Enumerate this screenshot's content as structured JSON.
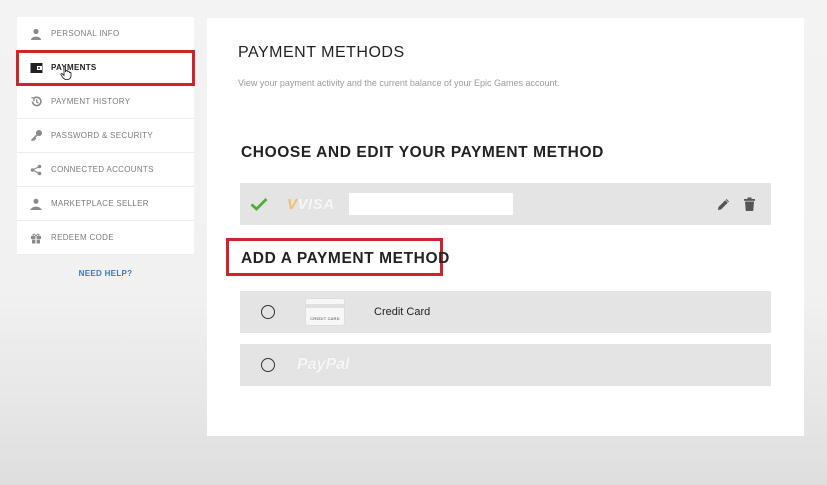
{
  "sidebar": {
    "items": [
      {
        "label": "PERSONAL INFO",
        "icon": "person-icon"
      },
      {
        "label": "PAYMENTS",
        "icon": "wallet-icon",
        "active": true
      },
      {
        "label": "PAYMENT HISTORY",
        "icon": "history-icon"
      },
      {
        "label": "PASSWORD & SECURITY",
        "icon": "key-icon"
      },
      {
        "label": "CONNECTED ACCOUNTS",
        "icon": "share-icon"
      },
      {
        "label": "MARKETPLACE SELLER",
        "icon": "seller-icon"
      },
      {
        "label": "REDEEM CODE",
        "icon": "gift-icon"
      }
    ],
    "need_help": "NEED HELP?"
  },
  "main": {
    "title": "PAYMENT METHODS",
    "subtitle": "View your payment activity and the current balance of your Epic Games account.",
    "choose_title": "CHOOSE AND EDIT YOUR PAYMENT METHOD",
    "saved_card": {
      "brand": "VISA",
      "icon": "check-icon",
      "actions": [
        "edit-icon",
        "trash-icon"
      ]
    },
    "add_title": "ADD A PAYMENT METHOD",
    "options": [
      {
        "label": "Credit Card",
        "icon_text": "CREDIT CARD"
      },
      {
        "label": "PayPal"
      }
    ]
  },
  "colors": {
    "highlight": "#d1232a",
    "check": "#4caf32",
    "row_bg": "#e4e4e4",
    "link": "#3a78b8"
  }
}
